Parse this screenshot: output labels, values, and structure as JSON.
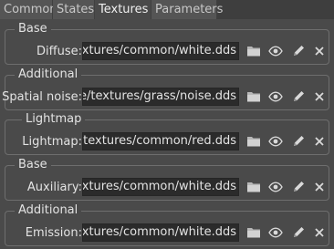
{
  "tabs": [
    {
      "label": "Common"
    },
    {
      "label": "States"
    },
    {
      "label": "Textures"
    },
    {
      "label": "Parameters"
    }
  ],
  "groups": [
    {
      "title": "Base",
      "label": "Diffuse:",
      "value": "/textures/common/white.dds"
    },
    {
      "title": "Additional",
      "label": "Spatial noise:",
      "value": "/core/textures/grass/noise.dds"
    },
    {
      "title": "Lightmap",
      "label": "Lightmap:",
      "value": "/core/textures/common/red.dds"
    },
    {
      "title": "Base",
      "label": "Auxiliary:",
      "value": "/textures/common/white.dds"
    },
    {
      "title": "Additional",
      "label": "Emission:",
      "value": "/textures/common/white.dds"
    }
  ],
  "icons": {
    "folder": "folder-icon",
    "eye": "eye-icon",
    "pen": "pencil-icon",
    "clear": "close-icon"
  },
  "colors": {
    "background": "#4a4a4a",
    "field": "#2b2b2b",
    "border": "#6e6e6e"
  }
}
